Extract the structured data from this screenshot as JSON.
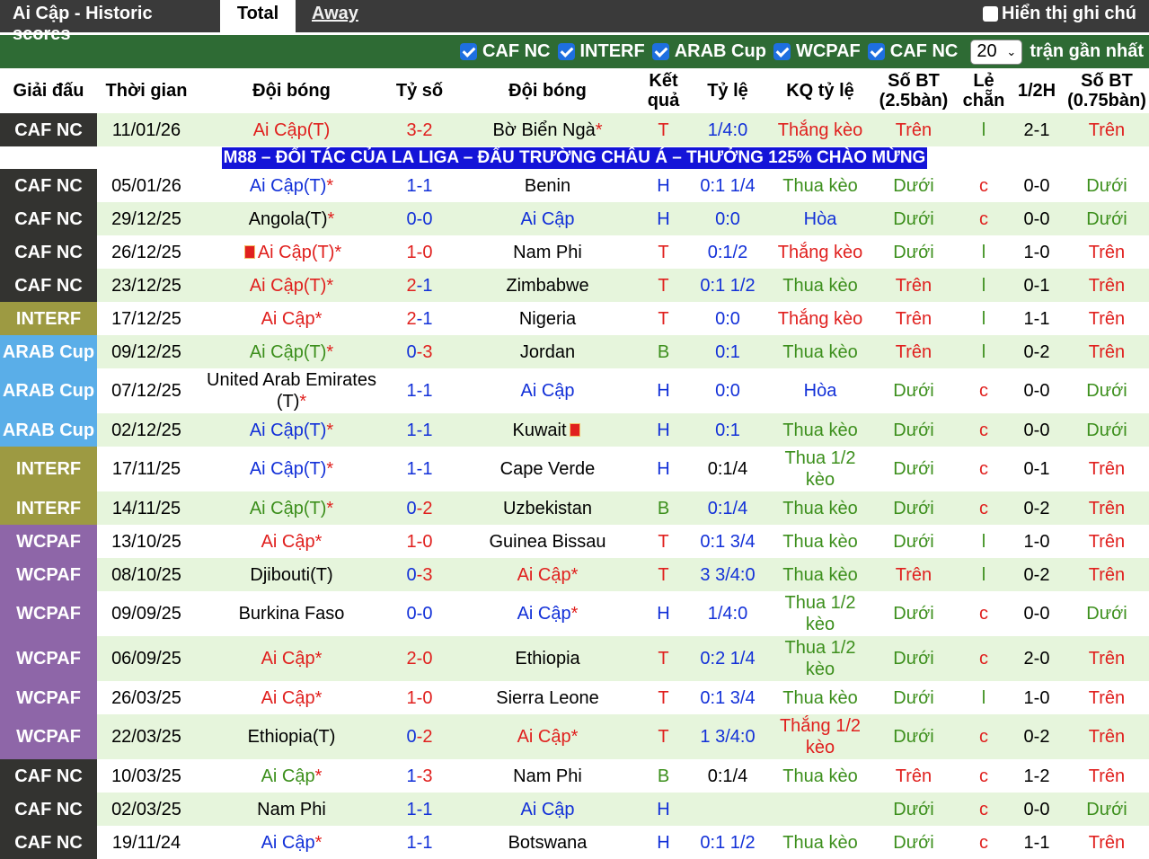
{
  "tabs": {
    "title": "Ai Cập - Historic scores",
    "total": "Total",
    "away": "Away",
    "show_notes": "Hiển thị ghi chú"
  },
  "filters": {
    "items": [
      "CAF NC",
      "INTERF",
      "ARAB Cup",
      "WCPAF",
      "CAF NC"
    ],
    "count": "20",
    "recent_label": "trận gần nhất"
  },
  "colors": {
    "CAF NC": "#333330",
    "INTERF": "#9d9a42",
    "ARAB Cup": "#5aaee8",
    "WCPAF": "#8e66a8",
    "row_light": "#e6f5dc",
    "row_white": "#ffffff",
    "banner": "#1414d8"
  },
  "headers": [
    "Giải đấu",
    "Thời gian",
    "Đội bóng",
    "Tỷ số",
    "Đội bóng",
    "Kết quả",
    "Tỷ lệ",
    "KQ tỷ lệ",
    "Số BT (2.5bàn)",
    "Lẻ chẵn",
    "1/2H",
    "Số BT (0.75bàn)"
  ],
  "banner": "M88 – ĐỐI TÁC CỦA LA LIGA – ĐẤU TRƯỜNG CHÂU Á – THƯỞNG 125% CHÀO MỪNG",
  "rows": [
    {
      "league": "CAF NC",
      "date": "11/01/26",
      "home": "Ai Cập(T)",
      "home_star": "",
      "home_c": "red",
      "home_flag": false,
      "s1": "3",
      "s1c": "red",
      "s2": "2",
      "s2c": "red",
      "away": "Bờ Biển Ngà",
      "away_star": "*",
      "away_c": "black",
      "away_flag": false,
      "res": "T",
      "odds": "1/4:0",
      "oddsc": "blue",
      "kq": "Thắng kèo",
      "kqc": "red",
      "ou": "Trên",
      "ouc": "red",
      "oe": "l",
      "oec": "green",
      "ht": "2-1",
      "ou2": "Trên",
      "ou2c": "red",
      "h": 37,
      "bg": "light"
    },
    {
      "league": "CAF NC",
      "date": "05/01/26",
      "home": "Ai Cập(T)",
      "home_star": "*",
      "home_c": "blue",
      "home_flag": false,
      "s1": "1",
      "s1c": "blue",
      "s2": "1",
      "s2c": "blue",
      "away": "Benin",
      "away_star": "",
      "away_c": "black",
      "away_flag": false,
      "res": "H",
      "odds": "0:1 1/4",
      "oddsc": "blue",
      "kq": "Thua kèo",
      "kqc": "green",
      "ou": "Dưới",
      "ouc": "green",
      "oe": "c",
      "oec": "red",
      "ht": "0-0",
      "ou2": "Dưới",
      "ou2c": "green",
      "h": 37,
      "bg": "white"
    },
    {
      "league": "CAF NC",
      "date": "29/12/25",
      "home": "Angola(T)",
      "home_star": "*",
      "home_c": "black",
      "home_flag": false,
      "s1": "0",
      "s1c": "blue",
      "s2": "0",
      "s2c": "blue",
      "away": "Ai Cập",
      "away_star": "",
      "away_c": "blue",
      "away_flag": false,
      "res": "H",
      "odds": "0:0",
      "oddsc": "blue",
      "kq": "Hòa",
      "kqc": "blue",
      "ou": "Dưới",
      "ouc": "green",
      "oe": "c",
      "oec": "red",
      "ht": "0-0",
      "ou2": "Dưới",
      "ou2c": "green",
      "h": 37,
      "bg": "light"
    },
    {
      "league": "CAF NC",
      "date": "26/12/25",
      "home": "Ai Cập(T)",
      "home_star": "*",
      "home_c": "red",
      "home_flag": true,
      "s1": "1",
      "s1c": "red",
      "s2": "0",
      "s2c": "red",
      "away": "Nam Phi",
      "away_star": "",
      "away_c": "black",
      "away_flag": false,
      "res": "T",
      "odds": "0:1/2",
      "oddsc": "blue",
      "kq": "Thắng kèo",
      "kqc": "red",
      "ou": "Dưới",
      "ouc": "green",
      "oe": "l",
      "oec": "green",
      "ht": "1-0",
      "ou2": "Trên",
      "ou2c": "red",
      "h": 37,
      "bg": "white"
    },
    {
      "league": "CAF NC",
      "date": "23/12/25",
      "home": "Ai Cập(T)",
      "home_star": "*",
      "home_c": "red",
      "home_flag": false,
      "s1": "2",
      "s1c": "red",
      "s2": "1",
      "s2c": "blue",
      "away": "Zimbabwe",
      "away_star": "",
      "away_c": "black",
      "away_flag": false,
      "res": "T",
      "odds": "0:1 1/2",
      "oddsc": "blue",
      "kq": "Thua kèo",
      "kqc": "green",
      "ou": "Trên",
      "ouc": "red",
      "oe": "l",
      "oec": "green",
      "ht": "0-1",
      "ou2": "Trên",
      "ou2c": "red",
      "h": 37,
      "bg": "light"
    },
    {
      "league": "INTERF",
      "date": "17/12/25",
      "home": "Ai Cập",
      "home_star": "*",
      "home_c": "red",
      "home_flag": false,
      "s1": "2",
      "s1c": "red",
      "s2": "1",
      "s2c": "blue",
      "away": "Nigeria",
      "away_star": "",
      "away_c": "black",
      "away_flag": false,
      "res": "T",
      "odds": "0:0",
      "oddsc": "blue",
      "kq": "Thắng kèo",
      "kqc": "red",
      "ou": "Trên",
      "ouc": "red",
      "oe": "l",
      "oec": "green",
      "ht": "1-1",
      "ou2": "Trên",
      "ou2c": "red",
      "h": 37,
      "bg": "white"
    },
    {
      "league": "ARAB Cup",
      "date": "09/12/25",
      "home": "Ai Cập(T)",
      "home_star": "*",
      "home_c": "green",
      "home_flag": false,
      "s1": "0",
      "s1c": "blue",
      "s2": "3",
      "s2c": "red",
      "away": "Jordan",
      "away_star": "",
      "away_c": "black",
      "away_flag": false,
      "res": "B",
      "odds": "0:1",
      "oddsc": "blue",
      "kq": "Thua kèo",
      "kqc": "green",
      "ou": "Trên",
      "ouc": "red",
      "oe": "l",
      "oec": "green",
      "ht": "0-2",
      "ou2": "Trên",
      "ou2c": "red",
      "h": 37,
      "bg": "light"
    },
    {
      "league": "ARAB Cup",
      "date": "07/12/25",
      "home": "United Arab Emirates (T)",
      "home_star": "*",
      "home_c": "black",
      "home_flag": false,
      "s1": "1",
      "s1c": "blue",
      "s2": "1",
      "s2c": "blue",
      "away": "Ai Cập",
      "away_star": "",
      "away_c": "blue",
      "away_flag": false,
      "res": "H",
      "odds": "0:0",
      "oddsc": "blue",
      "kq": "Hòa",
      "kqc": "blue",
      "ou": "Dưới",
      "ouc": "green",
      "oe": "c",
      "oec": "red",
      "ht": "0-0",
      "ou2": "Dưới",
      "ou2c": "green",
      "h": 50,
      "bg": "white"
    },
    {
      "league": "ARAB Cup",
      "date": "02/12/25",
      "home": "Ai Cập(T)",
      "home_star": "*",
      "home_c": "blue",
      "home_flag": false,
      "s1": "1",
      "s1c": "blue",
      "s2": "1",
      "s2c": "blue",
      "away": "Kuwait",
      "away_star": "",
      "away_c": "black",
      "away_flag": true,
      "res": "H",
      "odds": "0:1",
      "oddsc": "blue",
      "kq": "Thua kèo",
      "kqc": "green",
      "ou": "Dưới",
      "ouc": "green",
      "oe": "c",
      "oec": "red",
      "ht": "0-0",
      "ou2": "Dưới",
      "ou2c": "green",
      "h": 37,
      "bg": "light"
    },
    {
      "league": "INTERF",
      "date": "17/11/25",
      "home": "Ai Cập(T)",
      "home_star": "*",
      "home_c": "blue",
      "home_flag": false,
      "s1": "1",
      "s1c": "blue",
      "s2": "1",
      "s2c": "blue",
      "away": "Cape Verde",
      "away_star": "",
      "away_c": "black",
      "away_flag": false,
      "res": "H",
      "odds": "0:1/4",
      "oddsc": "black",
      "kq": "Thua 1/2 kèo",
      "kqc": "green",
      "ou": "Dưới",
      "ouc": "green",
      "oe": "c",
      "oec": "red",
      "ht": "0-1",
      "ou2": "Trên",
      "ou2c": "red",
      "h": 50,
      "bg": "white"
    },
    {
      "league": "INTERF",
      "date": "14/11/25",
      "home": "Ai Cập(T)",
      "home_star": "*",
      "home_c": "green",
      "home_flag": false,
      "s1": "0",
      "s1c": "blue",
      "s2": "2",
      "s2c": "red",
      "away": "Uzbekistan",
      "away_star": "",
      "away_c": "black",
      "away_flag": false,
      "res": "B",
      "odds": "0:1/4",
      "oddsc": "blue",
      "kq": "Thua kèo",
      "kqc": "green",
      "ou": "Dưới",
      "ouc": "green",
      "oe": "c",
      "oec": "red",
      "ht": "0-2",
      "ou2": "Trên",
      "ou2c": "red",
      "h": 37,
      "bg": "light"
    },
    {
      "league": "WCPAF",
      "date": "13/10/25",
      "home": "Ai Cập",
      "home_star": "*",
      "home_c": "red",
      "home_flag": false,
      "s1": "1",
      "s1c": "red",
      "s2": "0",
      "s2c": "red",
      "away": "Guinea Bissau",
      "away_star": "",
      "away_c": "black",
      "away_flag": false,
      "res": "T",
      "odds": "0:1 3/4",
      "oddsc": "blue",
      "kq": "Thua kèo",
      "kqc": "green",
      "ou": "Dưới",
      "ouc": "green",
      "oe": "l",
      "oec": "green",
      "ht": "1-0",
      "ou2": "Trên",
      "ou2c": "red",
      "h": 37,
      "bg": "white"
    },
    {
      "league": "WCPAF",
      "date": "08/10/25",
      "home": "Djibouti(T)",
      "home_star": "",
      "home_c": "black",
      "home_flag": false,
      "s1": "0",
      "s1c": "blue",
      "s2": "3",
      "s2c": "red",
      "away": "Ai Cập",
      "away_star": "*",
      "away_c": "red",
      "away_flag": false,
      "res": "T",
      "odds": "3 3/4:0",
      "oddsc": "blue",
      "kq": "Thua kèo",
      "kqc": "green",
      "ou": "Trên",
      "ouc": "red",
      "oe": "l",
      "oec": "green",
      "ht": "0-2",
      "ou2": "Trên",
      "ou2c": "red",
      "h": 37,
      "bg": "light"
    },
    {
      "league": "WCPAF",
      "date": "09/09/25",
      "home": "Burkina Faso",
      "home_star": "",
      "home_c": "black",
      "home_flag": false,
      "s1": "0",
      "s1c": "blue",
      "s2": "0",
      "s2c": "blue",
      "away": "Ai Cập",
      "away_star": "*",
      "away_c": "blue",
      "away_flag": false,
      "res": "H",
      "odds": "1/4:0",
      "oddsc": "blue",
      "kq": "Thua 1/2 kèo",
      "kqc": "green",
      "ou": "Dưới",
      "ouc": "green",
      "oe": "c",
      "oec": "red",
      "ht": "0-0",
      "ou2": "Dưới",
      "ou2c": "green",
      "h": 50,
      "bg": "white"
    },
    {
      "league": "WCPAF",
      "date": "06/09/25",
      "home": "Ai Cập",
      "home_star": "*",
      "home_c": "red",
      "home_flag": false,
      "s1": "2",
      "s1c": "red",
      "s2": "0",
      "s2c": "red",
      "away": "Ethiopia",
      "away_star": "",
      "away_c": "black",
      "away_flag": false,
      "res": "T",
      "odds": "0:2 1/4",
      "oddsc": "blue",
      "kq": "Thua 1/2 kèo",
      "kqc": "green",
      "ou": "Dưới",
      "ouc": "green",
      "oe": "c",
      "oec": "red",
      "ht": "2-0",
      "ou2": "Trên",
      "ou2c": "red",
      "h": 50,
      "bg": "light"
    },
    {
      "league": "WCPAF",
      "date": "26/03/25",
      "home": "Ai Cập",
      "home_star": "*",
      "home_c": "red",
      "home_flag": false,
      "s1": "1",
      "s1c": "red",
      "s2": "0",
      "s2c": "red",
      "away": "Sierra Leone",
      "away_star": "",
      "away_c": "black",
      "away_flag": false,
      "res": "T",
      "odds": "0:1 3/4",
      "oddsc": "blue",
      "kq": "Thua kèo",
      "kqc": "green",
      "ou": "Dưới",
      "ouc": "green",
      "oe": "l",
      "oec": "green",
      "ht": "1-0",
      "ou2": "Trên",
      "ou2c": "red",
      "h": 37,
      "bg": "white"
    },
    {
      "league": "WCPAF",
      "date": "22/03/25",
      "home": "Ethiopia(T)",
      "home_star": "",
      "home_c": "black",
      "home_flag": false,
      "s1": "0",
      "s1c": "blue",
      "s2": "2",
      "s2c": "red",
      "away": "Ai Cập",
      "away_star": "*",
      "away_c": "red",
      "away_flag": false,
      "res": "T",
      "odds": "1 3/4:0",
      "oddsc": "blue",
      "kq": "Thắng 1/2 kèo",
      "kqc": "red",
      "ou": "Dưới",
      "ouc": "green",
      "oe": "c",
      "oec": "red",
      "ht": "0-2",
      "ou2": "Trên",
      "ou2c": "red",
      "h": 50,
      "bg": "light"
    },
    {
      "league": "CAF NC",
      "date": "10/03/25",
      "home": "Ai Cập",
      "home_star": "*",
      "home_c": "green",
      "home_flag": false,
      "s1": "1",
      "s1c": "blue",
      "s2": "3",
      "s2c": "red",
      "away": "Nam Phi",
      "away_star": "",
      "away_c": "black",
      "away_flag": false,
      "res": "B",
      "odds": "0:1/4",
      "oddsc": "black",
      "kq": "Thua kèo",
      "kqc": "green",
      "ou": "Trên",
      "ouc": "red",
      "oe": "c",
      "oec": "red",
      "ht": "1-2",
      "ou2": "Trên",
      "ou2c": "red",
      "h": 37,
      "bg": "white"
    },
    {
      "league": "CAF NC",
      "date": "02/03/25",
      "home": "Nam Phi",
      "home_star": "",
      "home_c": "black",
      "home_flag": false,
      "s1": "1",
      "s1c": "blue",
      "s2": "1",
      "s2c": "blue",
      "away": "Ai Cập",
      "away_star": "",
      "away_c": "blue",
      "away_flag": false,
      "res": "H",
      "odds": "",
      "oddsc": "blue",
      "kq": "",
      "kqc": "green",
      "ou": "Dưới",
      "ouc": "green",
      "oe": "c",
      "oec": "red",
      "ht": "0-0",
      "ou2": "Dưới",
      "ou2c": "green",
      "h": 37,
      "bg": "light"
    },
    {
      "league": "CAF NC",
      "date": "19/11/24",
      "home": "Ai Cập",
      "home_star": "*",
      "home_c": "blue",
      "home_flag": false,
      "s1": "1",
      "s1c": "blue",
      "s2": "1",
      "s2c": "blue",
      "away": "Botswana",
      "away_star": "",
      "away_c": "black",
      "away_flag": false,
      "res": "H",
      "odds": "0:1 1/2",
      "oddsc": "blue",
      "kq": "Thua kèo",
      "kqc": "green",
      "ou": "Dưới",
      "ouc": "green",
      "oe": "c",
      "oec": "red",
      "ht": "1-1",
      "ou2": "Trên",
      "ou2c": "red",
      "h": 37,
      "bg": "white"
    }
  ]
}
